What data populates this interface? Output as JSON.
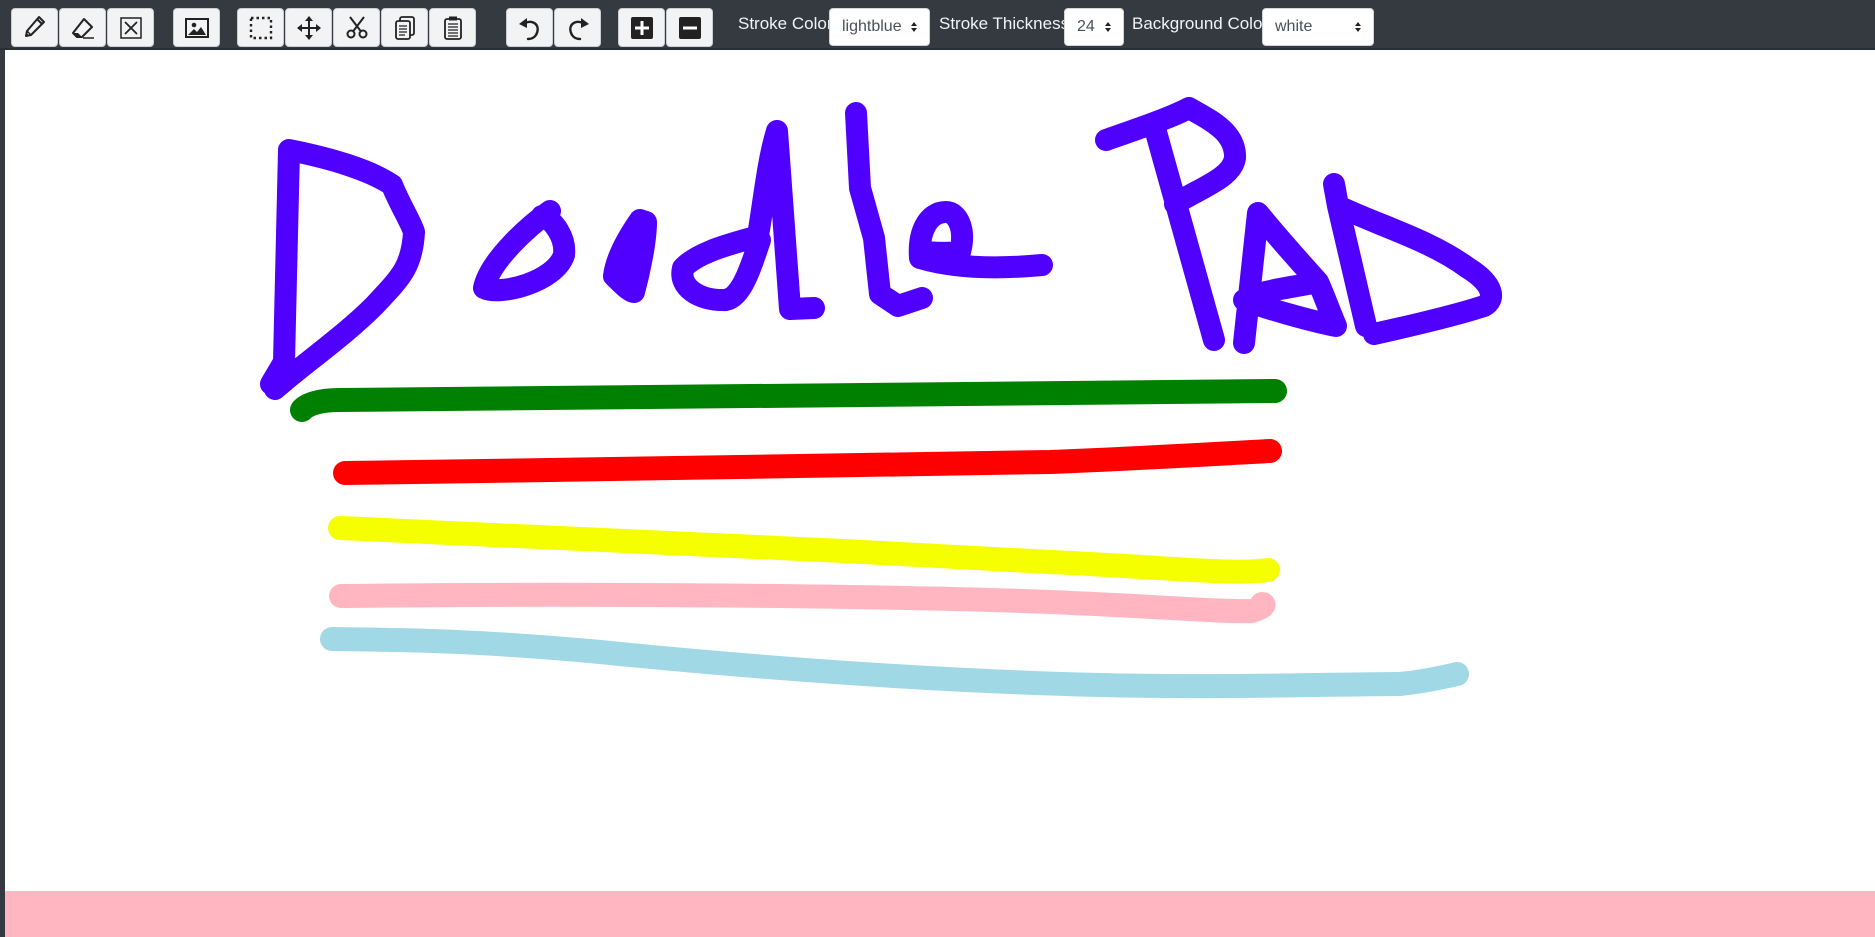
{
  "app": {
    "name": "Doodle Pad"
  },
  "toolbar": {
    "tools": [
      {
        "name": "pencil-icon"
      },
      {
        "name": "eraser-icon"
      },
      {
        "name": "clear-canvas-icon"
      },
      {
        "name": "image-icon"
      },
      {
        "name": "select-icon"
      },
      {
        "name": "move-icon"
      },
      {
        "name": "cut-icon"
      },
      {
        "name": "copy-icon"
      },
      {
        "name": "paste-icon"
      },
      {
        "name": "undo-icon"
      },
      {
        "name": "redo-icon"
      },
      {
        "name": "zoom-in-icon"
      },
      {
        "name": "zoom-out-icon"
      }
    ],
    "stroke_color_label": "Stroke Color",
    "stroke_color_value": "lightblue",
    "stroke_thickness_label": "Stroke Thickness",
    "stroke_thickness_value": "24",
    "background_color_label": "Background Color",
    "background_color_value": "white"
  },
  "canvas": {
    "strokes": [
      {
        "name": "title-letter-d",
        "color": "#5000ff"
      },
      {
        "name": "title-letter-o1",
        "color": "#5000ff"
      },
      {
        "name": "title-letter-o2",
        "color": "#5000ff"
      },
      {
        "name": "title-letter-d2",
        "color": "#5000ff"
      },
      {
        "name": "title-letter-l",
        "color": "#5000ff"
      },
      {
        "name": "title-letter-e",
        "color": "#5000ff"
      },
      {
        "name": "title-letter-p",
        "color": "#5000ff"
      },
      {
        "name": "title-letter-a",
        "color": "#5000ff"
      },
      {
        "name": "title-letter-d3",
        "color": "#5000ff"
      },
      {
        "name": "line-green",
        "color": "#008000"
      },
      {
        "name": "line-red",
        "color": "#ff0000"
      },
      {
        "name": "line-yellow",
        "color": "#f5ff00"
      },
      {
        "name": "line-pink",
        "color": "#ffb6c1"
      },
      {
        "name": "line-lightblue",
        "color": "#a0d9e5"
      }
    ]
  },
  "colors": {
    "toolbar_bg": "#343a40",
    "button_bg": "#f1f3f5",
    "bottom_strip": "#ffb6c1"
  }
}
